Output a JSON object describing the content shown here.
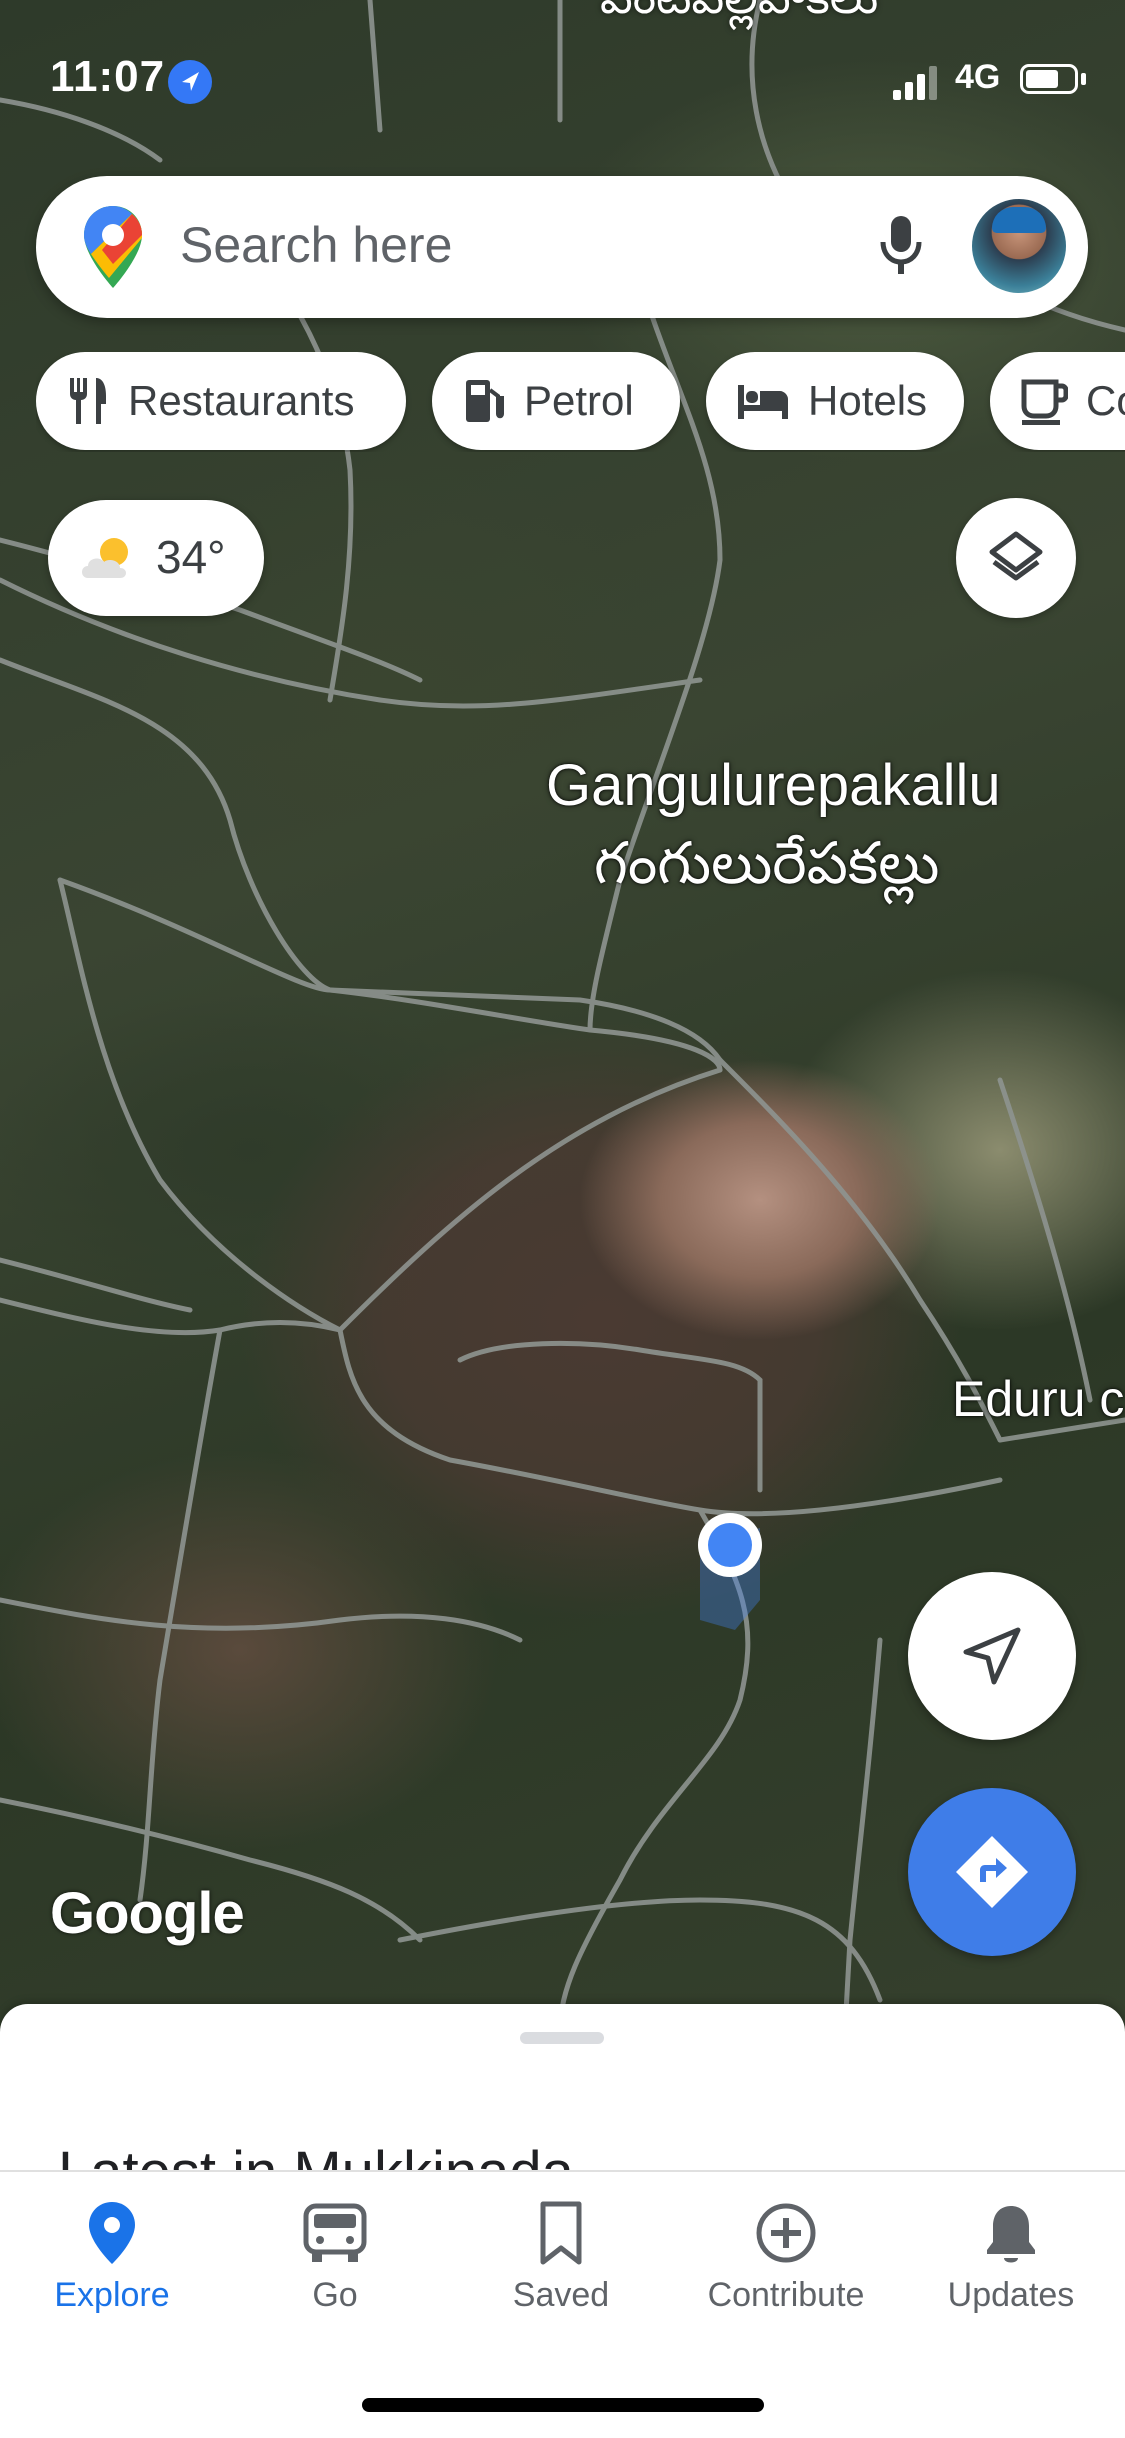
{
  "status_bar": {
    "time": "11:07",
    "network": "4G",
    "battery_level": 0.7
  },
  "map": {
    "top_partial_label": "పెంటపల్లిపాకలు",
    "place_name_en": "Gangulurepakallu",
    "place_name_te": "గంగులురేపకల్లు",
    "side_label": "Eduru c",
    "attribution": "Google"
  },
  "search": {
    "placeholder": "Search here"
  },
  "chips": [
    {
      "label": "Restaurants",
      "icon": "restaurant-icon"
    },
    {
      "label": "Petrol",
      "icon": "petrol-icon"
    },
    {
      "label": "Hotels",
      "icon": "hotel-icon"
    },
    {
      "label": "Co",
      "icon": "coffee-icon"
    }
  ],
  "weather": {
    "temp": "34°",
    "icon": "partly-cloudy-icon"
  },
  "sheet": {
    "peek_title": "Latest in Mukkinada"
  },
  "nav": [
    {
      "label": "Explore",
      "icon": "explore-pin-icon",
      "active": true
    },
    {
      "label": "Go",
      "icon": "car-icon",
      "active": false
    },
    {
      "label": "Saved",
      "icon": "bookmark-icon",
      "active": false
    },
    {
      "label": "Contribute",
      "icon": "add-circle-icon",
      "active": false
    },
    {
      "label": "Updates",
      "icon": "bell-icon",
      "active": false
    }
  ],
  "colors": {
    "accent": "#1a73e8",
    "directions_button": "#3f7de8",
    "location_dot": "#4285f4"
  }
}
